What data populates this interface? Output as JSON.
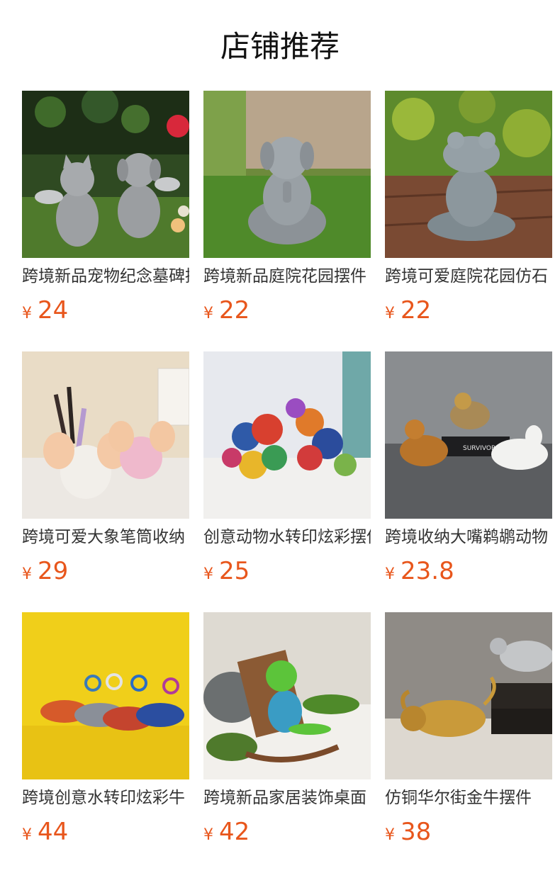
{
  "header": {
    "title": "店铺推荐"
  },
  "currency_symbol": "¥",
  "products": [
    {
      "name": "跨境新品宠物纪念墓碑摆件",
      "price": "24",
      "image": "pet-memorial-statues-image"
    },
    {
      "name": "跨境新品庭院花园摆件",
      "price": "22",
      "image": "meditating-dog-statue-image"
    },
    {
      "name": "跨境可爱庭院花园仿石",
      "price": "22",
      "image": "meditating-frog-statue-image"
    },
    {
      "name": "跨境可爱大象笔筒收纳",
      "price": "29",
      "image": "elephant-pen-holder-image"
    },
    {
      "name": "创意动物水转印炫彩摆件",
      "price": "25",
      "image": "balloon-dog-figurines-image"
    },
    {
      "name": "跨境收纳大嘴鹈鹕动物",
      "price": "23.8",
      "image": "pelican-storage-image"
    },
    {
      "name": "跨境创意水转印炫彩牛",
      "price": "44",
      "image": "graffiti-bull-figurines-image"
    },
    {
      "name": "跨境新品家居装饰桌面",
      "price": "42",
      "image": "frog-rocking-chair-image"
    },
    {
      "name": "仿铜华尔街金牛摆件",
      "price": "38",
      "image": "golden-bull-statue-image"
    }
  ]
}
